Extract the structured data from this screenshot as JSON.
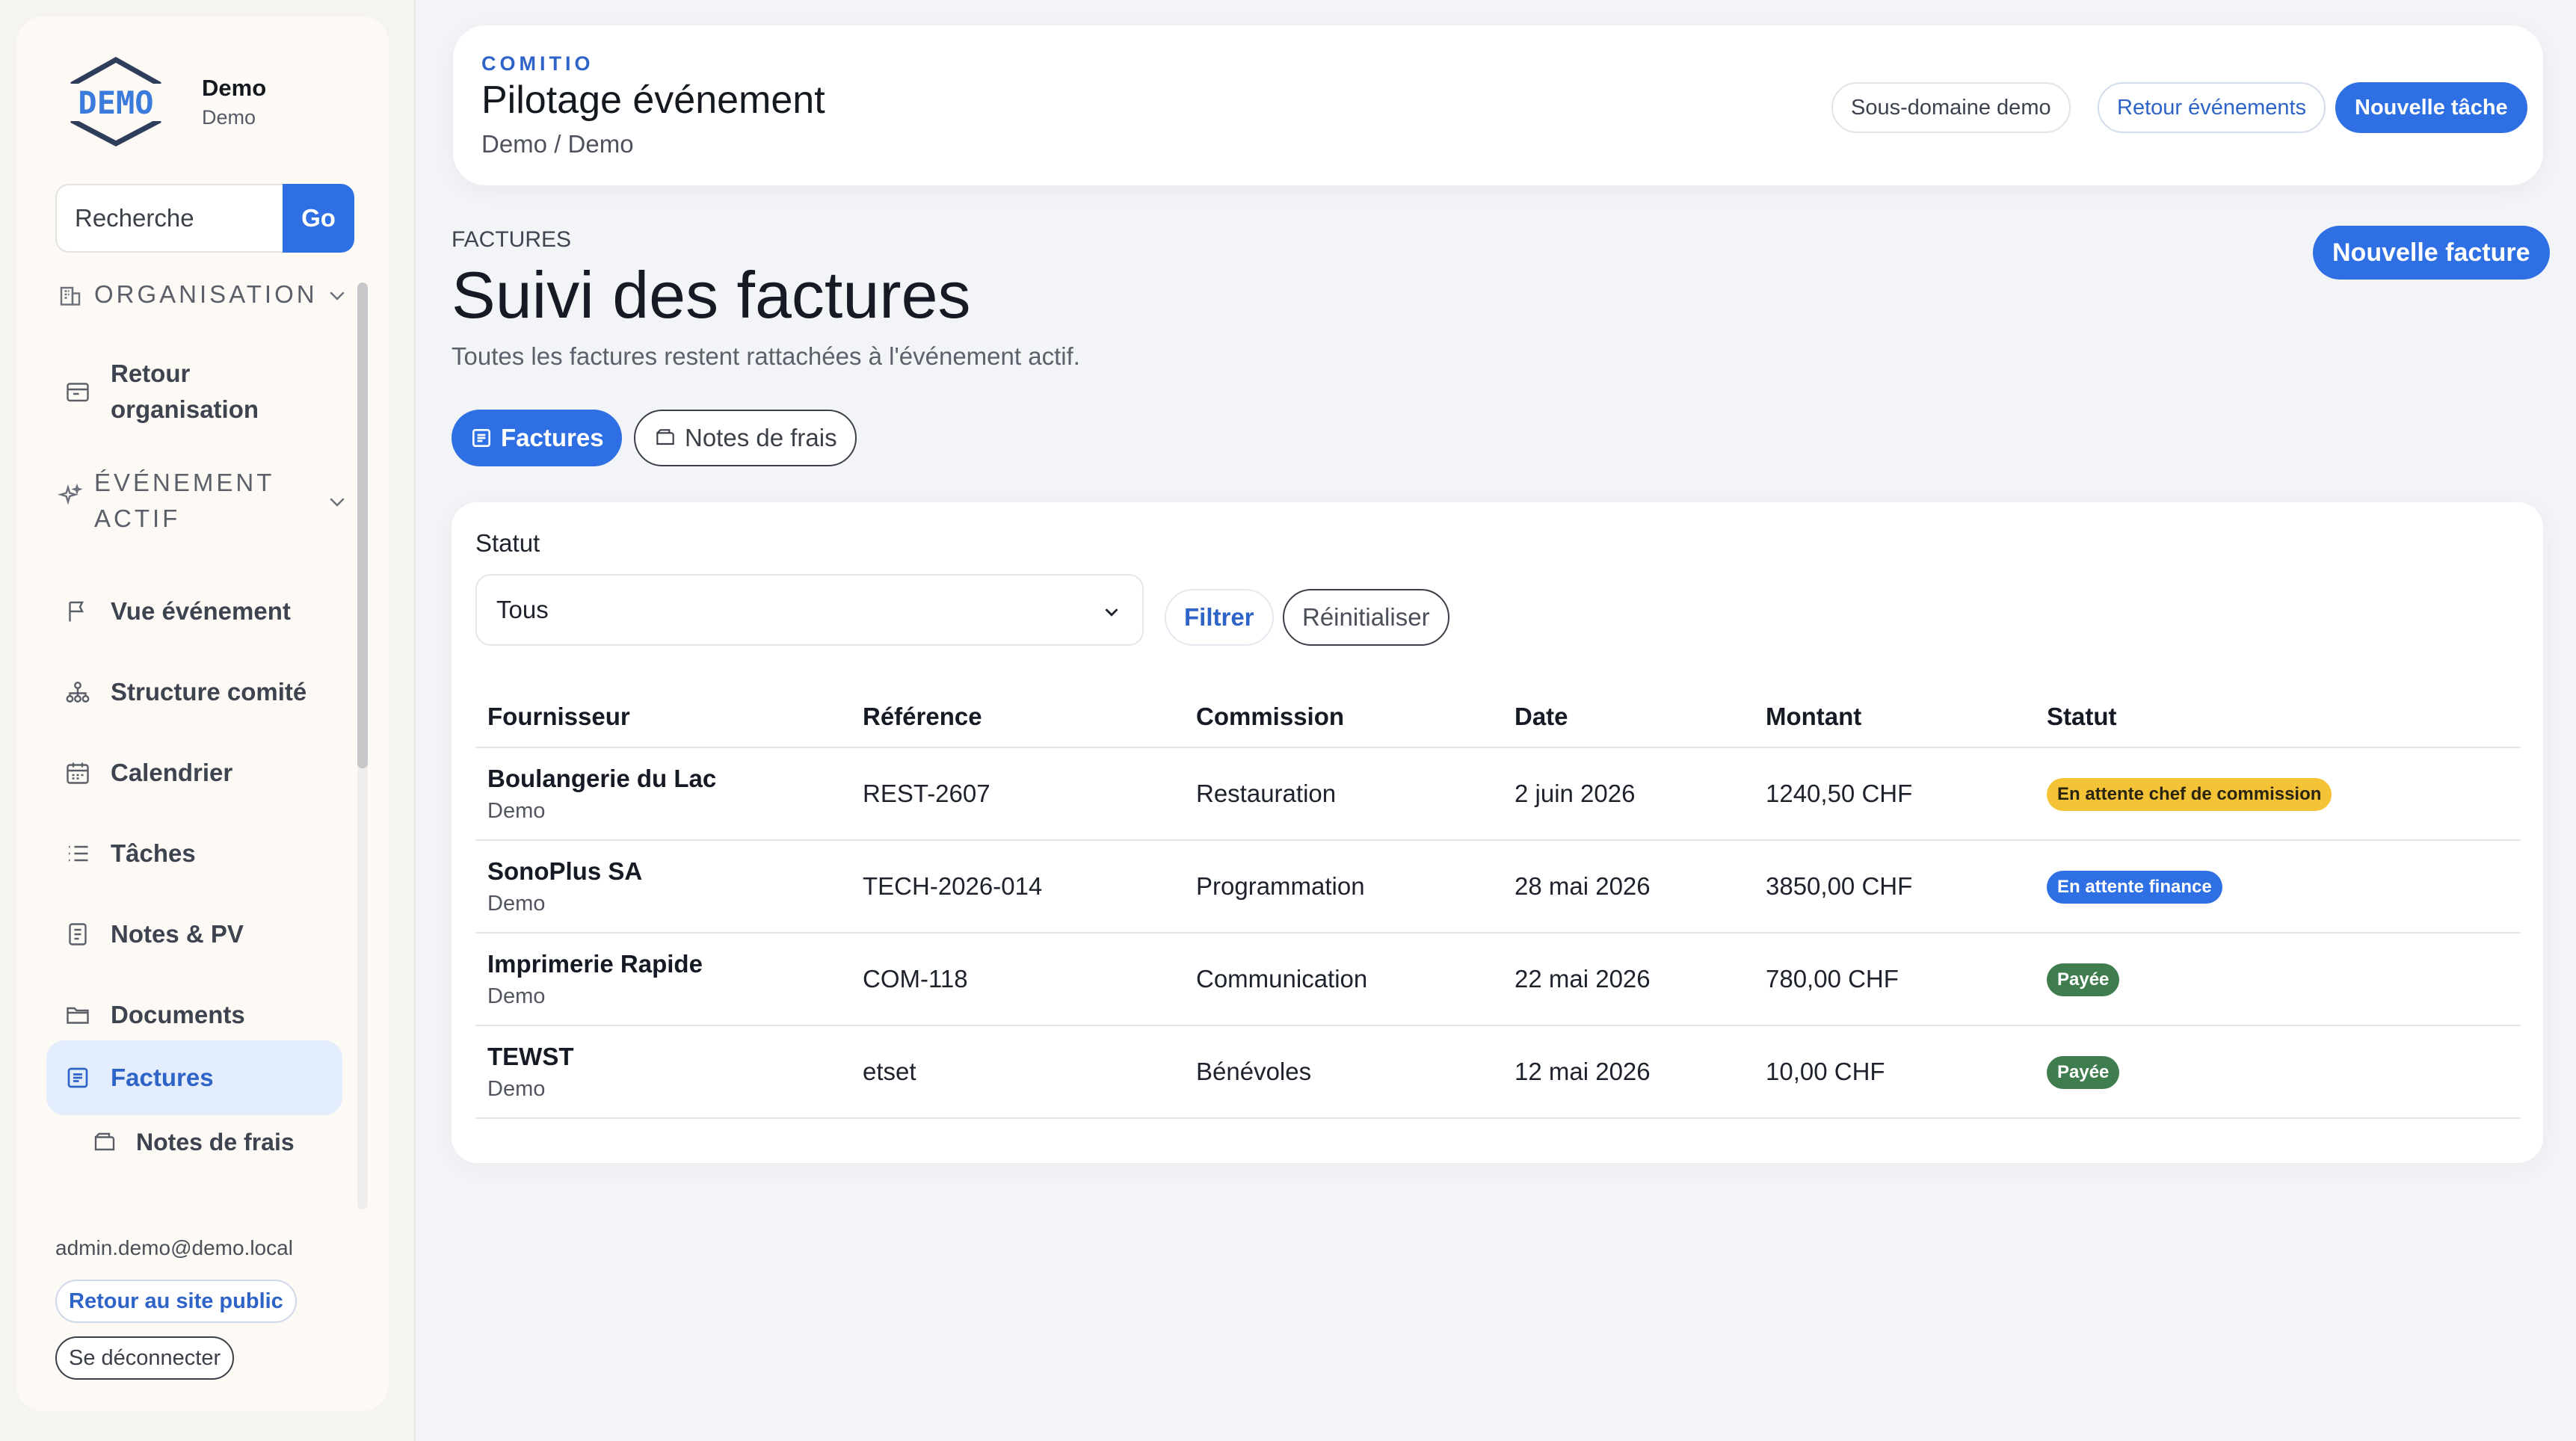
{
  "brand": {
    "name": "Demo",
    "subtitle": "Demo",
    "logo_text": "DEMO"
  },
  "search": {
    "placeholder": "Recherche",
    "button": "Go"
  },
  "sidebar": {
    "section_org": "ORGANISATION",
    "back_org": "Retour organisation",
    "section_event": "ÉVÉNEMENT ACTIF",
    "items": [
      {
        "label": "Vue événement",
        "icon": "flag-icon"
      },
      {
        "label": "Structure comité",
        "icon": "org-chart-icon"
      },
      {
        "label": "Calendrier",
        "icon": "calendar-icon"
      },
      {
        "label": "Tâches",
        "icon": "list-icon"
      },
      {
        "label": "Notes & PV",
        "icon": "notes-icon"
      },
      {
        "label": "Documents",
        "icon": "folder-icon"
      },
      {
        "label": "Factures",
        "icon": "invoice-icon",
        "active": true
      }
    ],
    "sub_item": "Notes de frais",
    "user_email": "admin.demo@demo.local",
    "public_site": "Retour au site public",
    "logout": "Se déconnecter"
  },
  "header": {
    "eyebrow": "COMITIO",
    "title": "Pilotage événement",
    "breadcrumb": "Demo / Demo",
    "buttons": [
      "Sous-domaine demo",
      "Retour événements",
      "Nouvelle tâche"
    ]
  },
  "page": {
    "eyebrow": "FACTURES",
    "title": "Suivi des factures",
    "subtitle": "Toutes les factures restent rattachées à l'événement actif.",
    "new_button": "Nouvelle facture",
    "tabs": [
      "Factures",
      "Notes de frais"
    ]
  },
  "filter": {
    "label": "Statut",
    "selected": "Tous",
    "apply": "Filtrer",
    "reset": "Réinitialiser"
  },
  "table": {
    "headers": [
      "Fournisseur",
      "Référence",
      "Commission",
      "Date",
      "Montant",
      "Statut"
    ],
    "rows": [
      {
        "supplier": "Boulangerie du Lac",
        "supplier_sub": "Demo",
        "reference": "REST-2607",
        "commission": "Restauration",
        "date": "2 juin 2026",
        "amount": "1240,50 CHF",
        "status": "En attente chef de commission",
        "status_color": "#f4c436"
      },
      {
        "supplier": "SonoPlus SA",
        "supplier_sub": "Demo",
        "reference": "TECH-2026-014",
        "commission": "Programmation",
        "date": "28 mai 2026",
        "amount": "3850,00 CHF",
        "status": "En attente finance",
        "status_color": "#2f6fe4"
      },
      {
        "supplier": "Imprimerie Rapide",
        "supplier_sub": "Demo",
        "reference": "COM-118",
        "commission": "Communication",
        "date": "22 mai 2026",
        "amount": "780,00 CHF",
        "status": "Payée",
        "status_color": "#3f7c4e"
      },
      {
        "supplier": "TEWST",
        "supplier_sub": "Demo",
        "reference": "etset",
        "commission": "Bénévoles",
        "date": "12 mai 2026",
        "amount": "10,00 CHF",
        "status": "Payée",
        "status_color": "#3f7c4e"
      }
    ]
  },
  "colors": {
    "accent": "#2f6fe4",
    "pending_manager": "#f4c436",
    "pending_finance": "#2f6fe4",
    "paid": "#3f7c4e"
  }
}
